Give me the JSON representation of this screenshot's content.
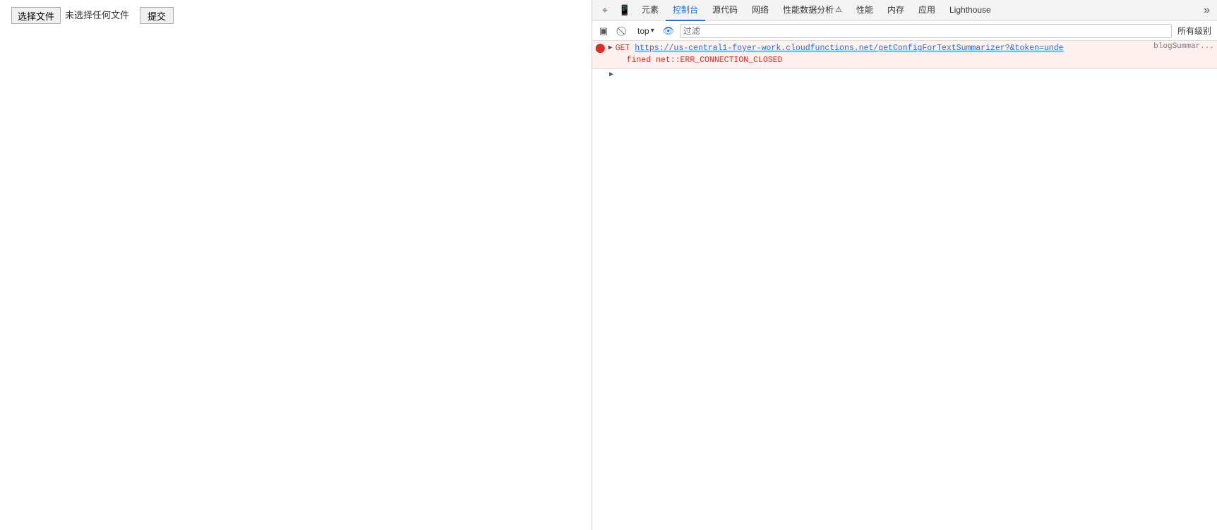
{
  "page": {
    "file_button_label": "选择文件",
    "file_status": "未选择任何文件",
    "submit_label": "提交"
  },
  "devtools": {
    "tabs": [
      {
        "id": "elements",
        "label": "元素",
        "active": false
      },
      {
        "id": "console",
        "label": "控制台",
        "active": true
      },
      {
        "id": "sources",
        "label": "源代码",
        "active": false
      },
      {
        "id": "network",
        "label": "网络",
        "active": false
      },
      {
        "id": "performance",
        "label": "性能数据分析",
        "active": false
      },
      {
        "id": "perf",
        "label": "性能",
        "active": false
      },
      {
        "id": "memory",
        "label": "内存",
        "active": false
      },
      {
        "id": "application",
        "label": "应用",
        "active": false
      },
      {
        "id": "lighthouse",
        "label": "Lighthouse",
        "active": false
      }
    ],
    "toolbar": {
      "top_selector": "top",
      "filter_placeholder": "过滤",
      "all_levels": "所有级别"
    },
    "console": {
      "error": {
        "method": "GET",
        "url": "https://us-central1-foyer-work.cloudfunctions.net/getConfigForTextSummarizer?&token=unde",
        "url_suffix": "fined",
        "error_msg": "net::ERR_CONNECTION_CLOSED",
        "source": "blogSummar..."
      }
    }
  }
}
